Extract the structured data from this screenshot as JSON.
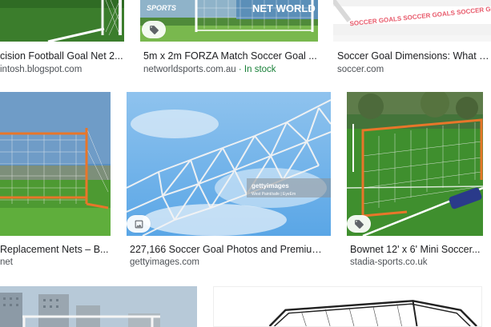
{
  "colors": {
    "title": "#202124",
    "source": "#4d5156",
    "in_stock": "#188038",
    "net_orange": "#e8762a",
    "grass": "#3f8f2e"
  },
  "results": [
    {
      "title": "cision Football Goal Net 2...",
      "source": "intosh.blogspot.com",
      "badge": null
    },
    {
      "title": "5m x 2m FORZA Match Soccer Goal ...",
      "source": "networldsports.com.au",
      "stock": "· In stock",
      "badge": "tag-icon",
      "watermark": "NET WORLD",
      "sign_text": "SPORTS"
    },
    {
      "title": "Soccer Goal Dimensions: What Size",
      "source": "soccer.com",
      "badge": null,
      "banner_text": "SOCCER GOALS SOCCER GOALS SOCCER GOALS"
    },
    {
      "title": "Replacement Nets – B...",
      "source": "net",
      "badge": null
    },
    {
      "title": "227,166 Soccer Goal Photos and Premium ...",
      "source": "gettyimages.com",
      "badge": "image-icon",
      "watermark": "gettyimages",
      "watermark_sub": "West Paint/safe | EyeEm"
    },
    {
      "title": "Bownet 12' x 6' Mini Soccer...",
      "source": "stadia-sports.co.uk",
      "badge": "tag-icon"
    },
    {
      "title": "",
      "source": "",
      "badge": null
    },
    {
      "title": "",
      "source": "",
      "badge": null
    }
  ]
}
